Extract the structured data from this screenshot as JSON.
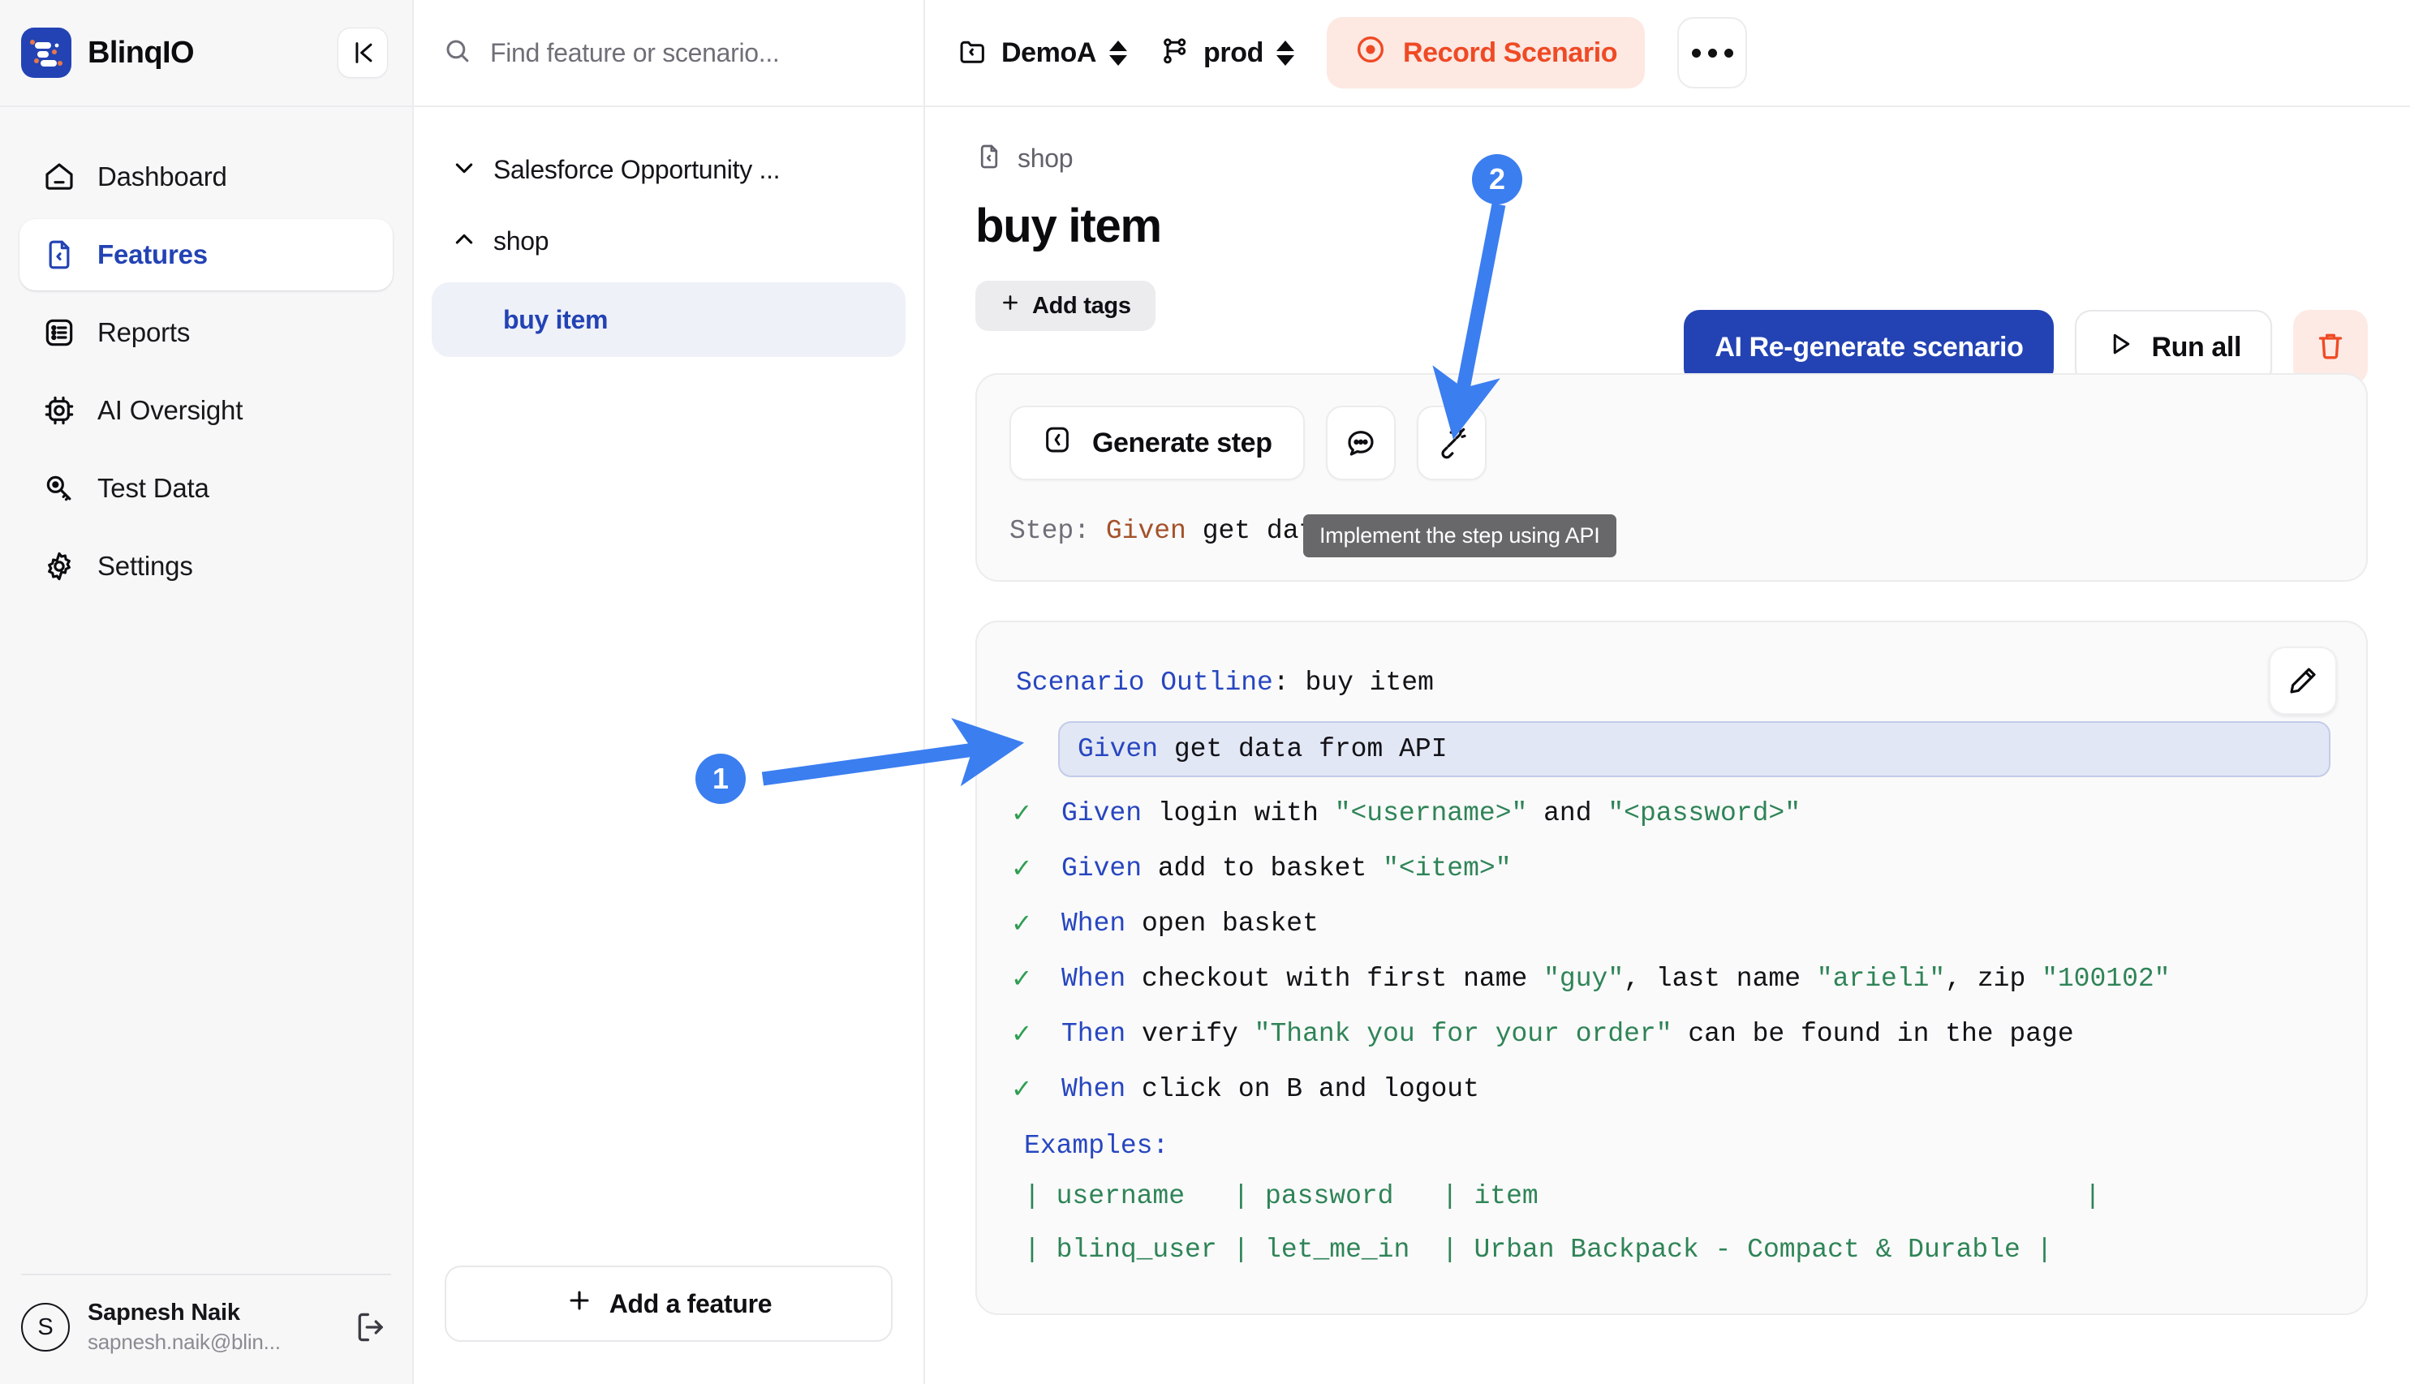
{
  "brand": {
    "name": "BlinqIO",
    "accent": "#2343b4"
  },
  "sidebar": {
    "collapse_icon": "collapse-panel-icon",
    "items": [
      {
        "label": "Dashboard",
        "icon": "home-icon",
        "active": false
      },
      {
        "label": "Features",
        "icon": "file-code-icon",
        "active": true
      },
      {
        "label": "Reports",
        "icon": "list-report-icon",
        "active": false
      },
      {
        "label": "AI Oversight",
        "icon": "chip-ai-icon",
        "active": false
      },
      {
        "label": "Test Data",
        "icon": "key-search-icon",
        "active": false
      },
      {
        "label": "Settings",
        "icon": "gear-icon",
        "active": false
      }
    ],
    "user": {
      "initial": "S",
      "name": "Sapnesh Naik",
      "email": "sapnesh.naik@blin...",
      "logout_icon": "logout-icon"
    }
  },
  "tree": {
    "search_placeholder": "Find feature or scenario...",
    "search_value": "",
    "nodes": [
      {
        "label": "Salesforce Opportunity ...",
        "expanded": false
      },
      {
        "label": "shop",
        "expanded": true
      }
    ],
    "leaf": {
      "label": "buy item",
      "selected": true
    },
    "add_feature_label": "Add a feature"
  },
  "topbar": {
    "project": "DemoA",
    "environment": "prod",
    "record_label": "Record Scenario",
    "record_color": "#ef4a25",
    "record_bg": "#fde8e2",
    "kebab_label": "more-options"
  },
  "header": {
    "breadcrumb": "shop",
    "title": "buy item",
    "add_tags_label": "Add tags",
    "regenerate_label": "AI  Re-generate scenario",
    "run_all_label": "Run all",
    "delete_label": "delete-scenario"
  },
  "generate_panel": {
    "generate_step_label": "Generate step",
    "comment_icon": "comment-bubble-icon",
    "api_icon": "plug-api-icon",
    "tooltip": "Implement the step using API",
    "step_prefix": "Step:",
    "step_keyword": "Given",
    "step_text": "get data from API"
  },
  "scenario": {
    "edit_icon": "pencil-edit-icon",
    "outline_keyword": "Scenario Outline",
    "outline_name": "buy item",
    "steps": [
      {
        "checked": false,
        "highlighted": true,
        "keyword": "Given",
        "parts": [
          {
            "t": "get data from API",
            "s": "plain"
          }
        ]
      },
      {
        "checked": true,
        "highlighted": false,
        "keyword": "Given",
        "parts": [
          {
            "t": "login with ",
            "s": "plain"
          },
          {
            "t": "\"<username>\"",
            "s": "str"
          },
          {
            "t": " and ",
            "s": "plain"
          },
          {
            "t": "\"<password>\"",
            "s": "str"
          }
        ]
      },
      {
        "checked": true,
        "highlighted": false,
        "keyword": "Given",
        "parts": [
          {
            "t": "add to basket ",
            "s": "plain"
          },
          {
            "t": "\"<item>\"",
            "s": "str"
          }
        ]
      },
      {
        "checked": true,
        "highlighted": false,
        "keyword": "When",
        "parts": [
          {
            "t": "open basket",
            "s": "plain"
          }
        ]
      },
      {
        "checked": true,
        "highlighted": false,
        "keyword": "When",
        "parts": [
          {
            "t": "checkout with first name ",
            "s": "plain"
          },
          {
            "t": "\"guy\"",
            "s": "str"
          },
          {
            "t": ", last name ",
            "s": "plain"
          },
          {
            "t": "\"arieli\"",
            "s": "str"
          },
          {
            "t": ", zip ",
            "s": "plain"
          },
          {
            "t": "\"100102\"",
            "s": "str"
          }
        ]
      },
      {
        "checked": true,
        "highlighted": false,
        "keyword": "Then",
        "parts": [
          {
            "t": "verify ",
            "s": "plain"
          },
          {
            "t": "\"Thank you for your order\"",
            "s": "str"
          },
          {
            "t": " can be found in the page",
            "s": "plain"
          }
        ]
      },
      {
        "checked": true,
        "highlighted": false,
        "keyword": "When",
        "parts": [
          {
            "t": "click on B and logout",
            "s": "plain"
          }
        ]
      }
    ],
    "examples_label": "Examples:",
    "examples_header_row": "| username   | password   | item                                  |",
    "examples_data_row": "| blinq_user | let_me_in  | Urban Backpack - Compact & Durable |"
  },
  "annotations": [
    {
      "id": "1",
      "label": "1",
      "color": "#3b7ef0"
    },
    {
      "id": "2",
      "label": "2",
      "color": "#3b7ef0"
    }
  ]
}
